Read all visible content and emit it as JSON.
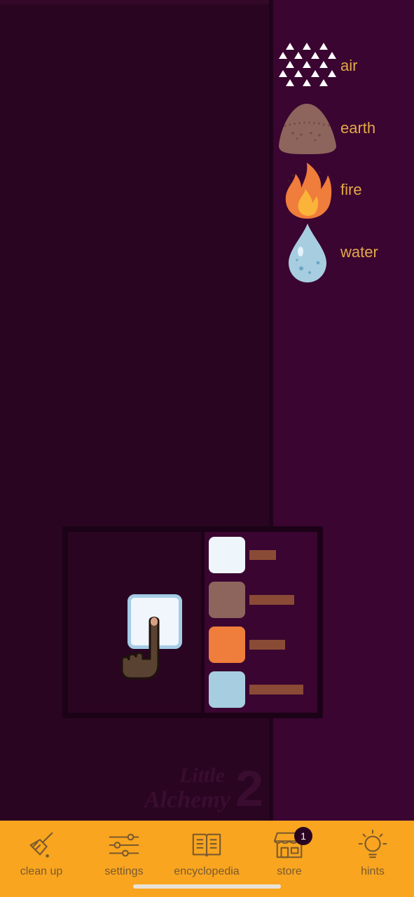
{
  "sidebar": {
    "items": [
      {
        "label": "air",
        "icon": "air-icon"
      },
      {
        "label": "earth",
        "icon": "earth-icon"
      },
      {
        "label": "fire",
        "icon": "fire-icon"
      },
      {
        "label": "water",
        "icon": "water-icon"
      }
    ]
  },
  "watermark": {
    "line1": "Little",
    "line2": "Alchemy",
    "num": "2"
  },
  "tutorial": {
    "swatches": [
      "#eef5fb",
      "#8e655c",
      "#ef7d3b",
      "#a7cde1"
    ],
    "bar_color": "#8a4b36"
  },
  "bottom_nav": {
    "items": [
      {
        "label": "clean up",
        "icon": "broom-icon"
      },
      {
        "label": "settings",
        "icon": "sliders-icon"
      },
      {
        "label": "encyclopedia",
        "icon": "book-icon"
      },
      {
        "label": "store",
        "icon": "store-icon"
      },
      {
        "label": "hints",
        "icon": "lightbulb-icon"
      }
    ],
    "store_badge": "1"
  },
  "colors": {
    "workspace": "#2a0522",
    "sidebar": "#3a0530",
    "accent": "#f9a51f",
    "label": "#e3a849"
  }
}
